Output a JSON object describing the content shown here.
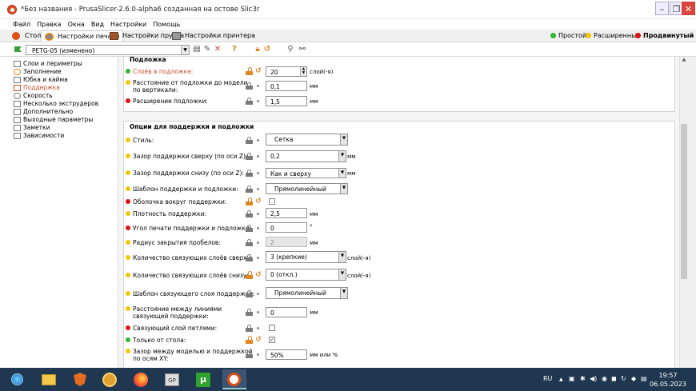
{
  "window": {
    "title": "*Без названия - PrusaSlicer-2.6.0-alpha6 созданная на остове Slic3r",
    "minimize": "–",
    "maximize": "❐",
    "close": "✕"
  },
  "menu": [
    "Файл",
    "Правка",
    "Окна",
    "Вид",
    "Настройки",
    "Помощь"
  ],
  "tabs": {
    "plater": "Стол",
    "print": "Настройки печати",
    "filament": "Настройки прутка",
    "printer": "Настройки принтера"
  },
  "modes": {
    "simple": "Простой",
    "advanced": "Расширенный",
    "expert": "Продвинутый"
  },
  "colors": {
    "simple": "#2db82d",
    "advanced": "#f2c800",
    "expert": "#e01010",
    "accent": "#e08520",
    "selected": "#c7502b"
  },
  "preset": {
    "value": "PETG-05 (изменено)"
  },
  "sidebar": [
    {
      "label": "Слои и периметры",
      "icon": "layers-icon"
    },
    {
      "label": "Заполнение",
      "icon": "infill-icon"
    },
    {
      "label": "Юбка и кайма",
      "icon": "skirt-icon"
    },
    {
      "label": "Поддержка",
      "icon": "support-icon",
      "selected": true
    },
    {
      "label": "Скорость",
      "icon": "speed-icon"
    },
    {
      "label": "Несколько экструдеров",
      "icon": "extruders-icon"
    },
    {
      "label": "Дополнительно",
      "icon": "advanced-icon"
    },
    {
      "label": "Выходные параметры",
      "icon": "output-icon"
    },
    {
      "label": "Заметки",
      "icon": "notes-icon"
    },
    {
      "label": "Зависимости",
      "icon": "dependencies-icon"
    }
  ],
  "raft": {
    "title": "Подложка",
    "layers": {
      "label": "Слоёв в подложке:",
      "value": "20",
      "unit": "слой(-я)",
      "level": "simple"
    },
    "contact_distance": {
      "label1": "Расстояние от подложки до модели",
      "label2": "по вертикали:",
      "value": "0,1",
      "unit": "мм",
      "level": "advanced"
    },
    "expansion": {
      "label": "Расширение подложки:",
      "value": "1,5",
      "unit": "мм",
      "level": "expert"
    }
  },
  "options": {
    "title": "Опции для поддержки и подложки",
    "style": {
      "label": "Стиль:",
      "value": "Сетка"
    },
    "top_z": {
      "label": "Зазор поддержки сверху (по оси Z):",
      "value": "0,2",
      "unit": "мм"
    },
    "bottom_z": {
      "label": "Зазор поддержки снизу (по оси Z):",
      "value": "Как и сверху",
      "unit": "мм"
    },
    "pattern": {
      "label": "Шаблон поддержки и подложки:",
      "value": "Прямолинейный"
    },
    "with_sheath": {
      "label": "Оболочка вокруг поддержки:",
      "checked": false
    },
    "spacing": {
      "label": "Плотность поддержки:",
      "value": "2,5",
      "unit": "мм"
    },
    "angle": {
      "label": "Угол печати поддержки и подложки:",
      "value": "0",
      "unit": "°"
    },
    "closing_radius": {
      "label": "Радиус закрытия пробелов:",
      "value": "2",
      "unit": "мм"
    },
    "top_interface_layers": {
      "label": "Количество связующих слоёв сверху:",
      "value": "3 (крепкие)",
      "unit": "слой(-я)"
    },
    "bottom_interface_layers": {
      "label": "Количество связующих слоёв снизу:",
      "value": "0 (откл.)",
      "unit": "слой(-я)"
    },
    "interface_pattern": {
      "label": "Шаблон связующего слоя поддержки:",
      "value": "Прямолинейный"
    },
    "interface_spacing": {
      "label1": "Расстояние между линиями",
      "label2": "связующей поддержки:",
      "value": "0",
      "unit": "мм"
    },
    "interface_loops": {
      "label": "Связующий слой петлями:",
      "checked": false
    },
    "buildplate_only": {
      "label": "Только от стола:",
      "checked": true,
      "mark": "✓"
    },
    "xy_separation": {
      "label1": "Зазор между моделью и поддержкой",
      "label2": "по осям XY:",
      "value": "50%",
      "unit": "мм или %"
    }
  },
  "taskbar": {
    "lang": "RU",
    "time": "19:57",
    "date": "06.05.2023"
  }
}
